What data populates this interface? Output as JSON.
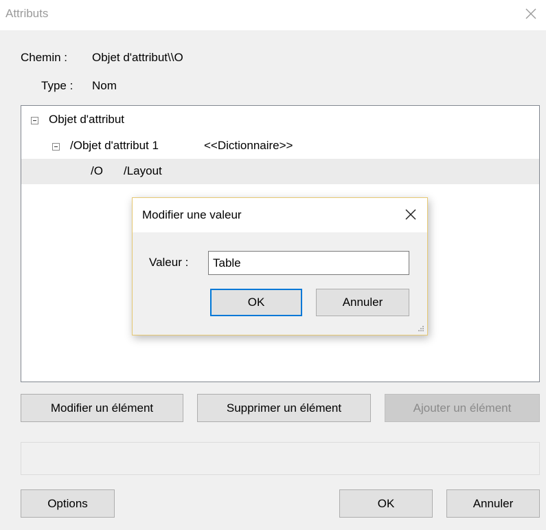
{
  "window": {
    "title": "Attributs",
    "close_icon": "close-icon"
  },
  "fields": {
    "path_label": "Chemin :",
    "path_value": "Objet d'attribut\\\\O",
    "type_label": "Type :",
    "type_value": "Nom"
  },
  "tree": {
    "root": {
      "label": "Objet d'attribut",
      "expanded": true
    },
    "child": {
      "label": "/Objet d'attribut 1",
      "tag": "<<Dictionnaire>>",
      "expanded": true
    },
    "leaf": {
      "key": "/O",
      "value": "/Layout",
      "selected": true
    }
  },
  "actions": {
    "modify": "Modifier un élément",
    "delete": "Supprimer un élément",
    "add": "Ajouter un élément",
    "add_disabled": true
  },
  "footer": {
    "options": "Options",
    "ok": "OK",
    "cancel": "Annuler"
  },
  "dialog": {
    "title": "Modifier une valeur",
    "value_label": "Valeur :",
    "value": "Table",
    "ok": "OK",
    "cancel": "Annuler"
  },
  "colors": {
    "accent": "#0078d7",
    "selection": "#ebebeb",
    "dialog_border": "#e6c873",
    "disabled_text": "#8a8a8a"
  }
}
